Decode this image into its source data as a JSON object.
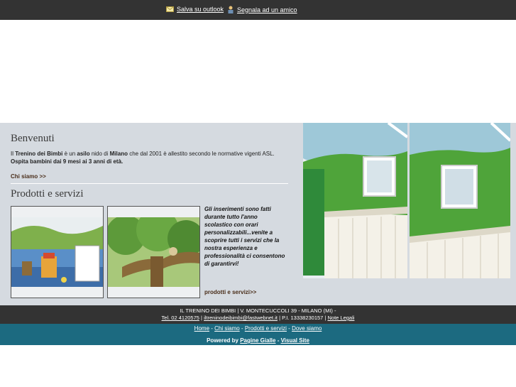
{
  "toolbar": {
    "save_label": "Salva su outlook",
    "share_label": "Segnala ad un amico"
  },
  "welcome": {
    "title": "Benvenuti",
    "text_pre": "Il ",
    "text_brand": "Trenino dei Bimbi",
    "text_mid1": " è un ",
    "text_asilo": "asilo",
    "text_mid2": " nido di ",
    "text_city": "Milano",
    "text_post": " che dal 2001 è allestito secondo le normative vigenti ASL.",
    "text_bold2": "Ospita bambini dai 9 mesi ai 3 anni di età.",
    "more_link": "Chi siamo >>"
  },
  "products": {
    "title": "Prodotti e servizi",
    "description": "Gli inserimenti sono fatti durante tutto l'anno scolastico con orari personalizzabili...venite a scoprire tutti i servizi che la nostra esperienza e professionalità ci consentono di garantirvi!",
    "more_link": "prodotti e servizi>>"
  },
  "footer": {
    "address": "IL TRENINO DEI BIMBI | V. MONTECUCCOLI 39 - MILANO (MI) -",
    "phone": "Tel. 02 4120575",
    "sep1": " | ",
    "email": "iltreninodeibimbi@fastwebnet.it",
    "piva": " | P.I. 13338230157 | ",
    "legal": "Note Legali",
    "nav": [
      "Home",
      "Chi siamo",
      "Prodotti e servizi",
      "Dove siamo"
    ],
    "nav_sep": " - ",
    "powered_prefix": "Powered by ",
    "powered_link1": "Pagine Gialle",
    "powered_sep": " - ",
    "powered_link2": "Visual Site"
  },
  "colors": {
    "topbar": "#333333",
    "content_bg": "#d5dae0",
    "footer_dark": "#333333",
    "footer_teal": "#1c6a80",
    "link_brown": "#4a2e1a"
  }
}
